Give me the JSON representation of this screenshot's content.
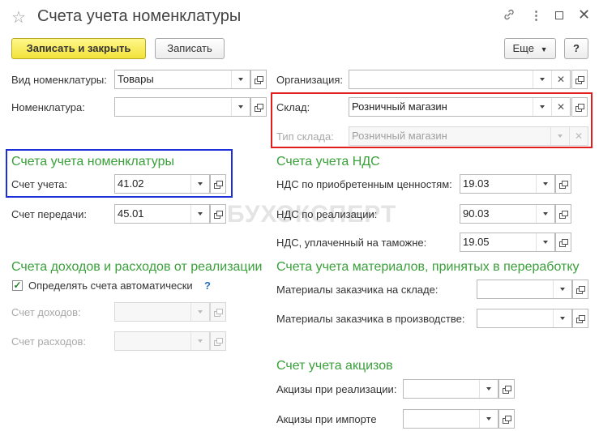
{
  "window": {
    "title": "Счета учета номенклатуры"
  },
  "toolbar": {
    "save_close": "Записать и закрыть",
    "save": "Записать",
    "more": "Еще",
    "help": "?"
  },
  "watermark": "БУХЭКСПЕРТ",
  "top": {
    "nomenclature_type": {
      "label": "Вид номенклатуры:",
      "value": "Товары"
    },
    "nomenclature": {
      "label": "Номенклатура:",
      "value": ""
    },
    "organization": {
      "label": "Организация:",
      "value": ""
    },
    "warehouse": {
      "label": "Склад:",
      "value": "Розничный магазин"
    },
    "warehouse_type": {
      "label": "Тип склада:",
      "value": "Розничный магазин"
    }
  },
  "accounts": {
    "title": "Счета учета номенклатуры",
    "account": {
      "label": "Счет учета:",
      "value": "41.02"
    },
    "transfer": {
      "label": "Счет передачи:",
      "value": "45.01"
    }
  },
  "vat": {
    "title": "Счета учета НДС",
    "acquired": {
      "label": "НДС по приобретенным ценностям:",
      "value": "19.03"
    },
    "sales": {
      "label": "НДС по реализации:",
      "value": "90.03"
    },
    "customs": {
      "label": "НДС, уплаченный на таможне:",
      "value": "19.05"
    }
  },
  "income": {
    "title": "Счета доходов и расходов от реализации",
    "auto": {
      "label": "Определять счета автоматически",
      "help": "?",
      "checked": true
    },
    "income_account": {
      "label": "Счет доходов:",
      "value": ""
    },
    "expense_account": {
      "label": "Счет расходов:",
      "value": ""
    }
  },
  "materials": {
    "title": "Счета учета материалов, принятых в переработку",
    "warehouse": {
      "label": "Материалы заказчика на складе:",
      "value": ""
    },
    "production": {
      "label": "Материалы заказчика в производстве:",
      "value": ""
    }
  },
  "excise": {
    "title": "Счет учета акцизов",
    "sales": {
      "label": "Акцизы при реализации:",
      "value": ""
    },
    "import": {
      "label": "Акцизы при импорте",
      "value": ""
    }
  },
  "colors": {
    "section": "#3aa03a",
    "highlight_red": "#e31c1c",
    "highlight_blue": "#1c2fd8",
    "primary_button": "#f3e23a"
  }
}
